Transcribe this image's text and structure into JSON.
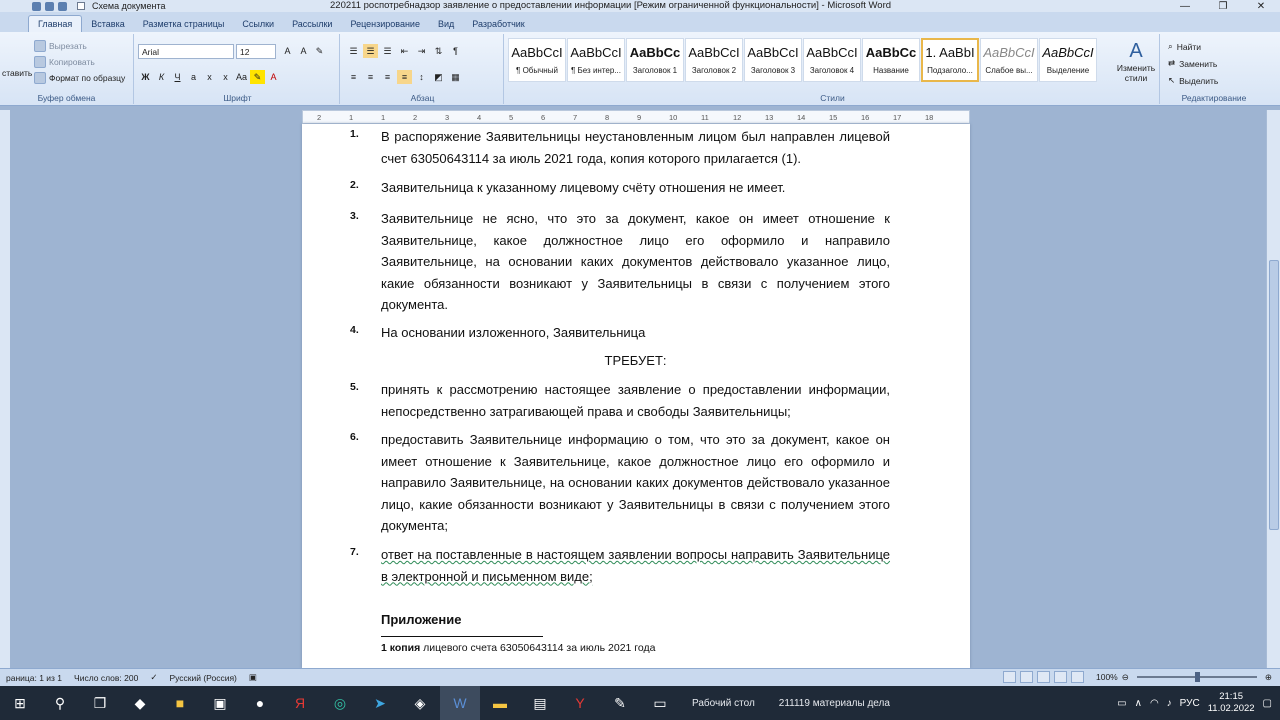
{
  "window": {
    "title": "220211 роспотребнадзор заявление о предоставлении информации [Режим ограниченной функциональности] - Microsoft Word",
    "qat_label": "Схема документа",
    "controls": [
      "—",
      "❐",
      "✕"
    ]
  },
  "ribbon_tabs": [
    "Главная",
    "Вставка",
    "Разметка страницы",
    "Ссылки",
    "Рассылки",
    "Рецензирование",
    "Вид",
    "Разработчик"
  ],
  "clipboard": {
    "paste": "ставить",
    "cut": "Вырезать",
    "copy": "Копировать",
    "format_painter": "Формат по образцу",
    "label": "Буфер обмена"
  },
  "font": {
    "name": "Arial",
    "size": "12",
    "label": "Шрифт"
  },
  "paragraph": {
    "label": "Абзац"
  },
  "styles": {
    "items": [
      {
        "sample": "AaBbCcI",
        "name": "¶ Обычный"
      },
      {
        "sample": "AaBbCcI",
        "name": "¶ Без интер..."
      },
      {
        "sample": "AaBbCc",
        "name": "Заголовок 1"
      },
      {
        "sample": "AaBbCcI",
        "name": "Заголовок 2"
      },
      {
        "sample": "AaBbCcI",
        "name": "Заголовок 3"
      },
      {
        "sample": "AaBbCcI",
        "name": "Заголовок 4"
      },
      {
        "sample": "AaBbCc",
        "name": "Название"
      },
      {
        "sample": "1. AaBbI",
        "name": "Подзаголо..."
      },
      {
        "sample": "AaBbCcI",
        "name": "Слабое вы..."
      },
      {
        "sample": "AaBbCcI",
        "name": "Выделение"
      }
    ],
    "change": "Изменить стили",
    "label": "Стили"
  },
  "editing": {
    "find": "Найти",
    "replace": "Заменить",
    "select": "Выделить",
    "label": "Редактирование"
  },
  "ruler": [
    "2",
    "1",
    "1",
    "2",
    "3",
    "4",
    "5",
    "6",
    "7",
    "8",
    "9",
    "10",
    "11",
    "12",
    "13",
    "14",
    "15",
    "16",
    "17",
    "18"
  ],
  "document": {
    "items": [
      {
        "num": "1.",
        "text": "В распоряжение Заявительницы неустановленным лицом был направлен лицевой счет 63050643114 за июль 2021 года, копия которого прилагается (1)."
      },
      {
        "num": "2.",
        "text": "Заявительница к указанному лицевому счёту отношения не имеет."
      },
      {
        "num": "3.",
        "text": "Заявительнице не ясно, что это за документ, какое он имеет отношение к Заявительнице, какое должностное лицо его оформило и направило Заявительнице, на основании каких документов действовало указанное лицо, какие обязанности возникают у Заявительницы в связи с получением этого документа."
      },
      {
        "num": "4.",
        "text": "На основании изложенного, Заявительница"
      },
      {
        "num": "5.",
        "text": "принять к рассмотрению настоящее заявление о предоставлении информации, непосредственно затрагивающей права и свободы Заявительницы;"
      },
      {
        "num": "6.",
        "text": "предоставить Заявительнице информацию о том, что это за документ, какое он имеет отношение к Заявительнице, какое должностное лицо его оформило и направило Заявительнице, на основании каких документов действовало указанное лицо, какие обязанности возникают у Заявительницы в связи с получением этого документа;"
      },
      {
        "num": "7.",
        "text": "ответ на поставленные в настоящем заявлении вопросы направить Заявительнице в электронной и письменном виде;"
      }
    ],
    "demand": "ТРЕБУЕТ:",
    "attachment_heading": "Приложение",
    "attachment_bold": "1 копия",
    "attachment_rest": " лицевого счета 63050643114 за июль 2021 года"
  },
  "status": {
    "page": "раница: 1 из 1",
    "words": "Число слов: 200",
    "language": "Русский (Россия)",
    "zoom": "100%"
  },
  "taskbar": {
    "desktop_label": "Рабочий стол",
    "folder_label": "211119 материалы дела",
    "lang": "РУС",
    "time": "21:15",
    "date": "11.02.2022"
  }
}
